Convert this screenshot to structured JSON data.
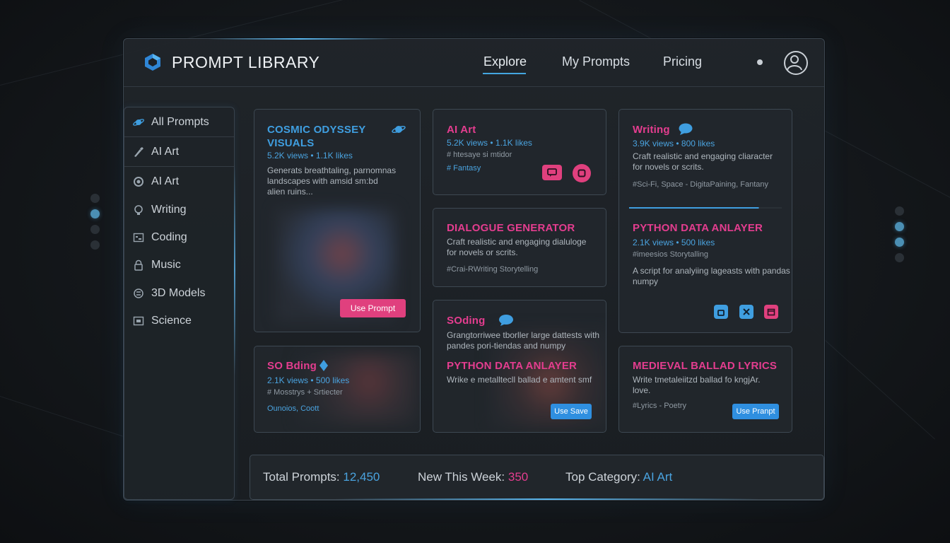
{
  "app": {
    "title": "PROMPT LIBRARY"
  },
  "nav": {
    "explore": "Explore",
    "my_prompts": "My Prompts",
    "pricing": "Pricing"
  },
  "sidebar": {
    "items": [
      {
        "label": "All Prompts",
        "icon": "planet-icon"
      },
      {
        "label": "AI Art",
        "icon": "brush-icon"
      },
      {
        "label": "AI Art",
        "icon": "circle-icon"
      },
      {
        "label": "Writing",
        "icon": "bulb-icon"
      },
      {
        "label": "Coding",
        "icon": "code-icon"
      },
      {
        "label": "Music",
        "icon": "lock-icon"
      },
      {
        "label": "3D Models",
        "icon": "cube-icon"
      },
      {
        "label": "Science",
        "icon": "flask-icon"
      }
    ]
  },
  "cards": {
    "cosmic": {
      "title_line1": "COSMIC ODYSSEY",
      "title_line2": "VISUALS",
      "stats": "5.2K views • 1.1K likes",
      "desc_line1": "Generats breathtaling, parnomnas",
      "desc_line2": "landscapes with amsid sm:bd",
      "desc_line3": "alien ruins...",
      "button": "Use Prompt"
    },
    "aiart": {
      "title": "AI Art",
      "stats": "5.2K views • 1.1K likes",
      "sub": "# htesaye si mtidor",
      "tags": "# Fantasy"
    },
    "writing": {
      "title": "Writing",
      "stats": "3.9K views • 800 likes",
      "desc_line1": "Craft realistic and engaging cliaracter",
      "desc_line2": "for novels or scrits.",
      "tags": "#Sci-Fi, Space - DigitaPaining, Fantany"
    },
    "dialogue": {
      "title": "DIALOGUE GENERATOR",
      "desc_line1": "Craft realistic and engaging dialuloge",
      "desc_line2": "for novels or scrits.",
      "tags": "#Crai-RWriting Storytelling"
    },
    "python_right": {
      "title": "PYTHON DATA ANLAYER",
      "stats": "2.1K views • 500 likes",
      "sub": "#imeesios Storytalling",
      "desc_line1": "A script for analyiing lageasts with pandas",
      "desc_line2": "numpy"
    },
    "sodbing": {
      "title": "SO Bding",
      "stats": "2.1K views • 500 likes",
      "sub": "# Mosstrys + Srtiecter",
      "tags": "Ounoios, Coott"
    },
    "soding_python": {
      "title": "SOding",
      "desc_line1": "Grangtorriwee tborller large dattests with",
      "desc_line2": "pandes pori-tiendas and numpy",
      "title2": "PYTHON DATA ANLAYER",
      "desc2": "Wrike e metalltecll ballad e amtent smf",
      "button": "Use Save"
    },
    "medieval": {
      "title": "MEDIEVAL BALLAD LYRICS",
      "desc_line1": "Write tmetaleiitzd ballad fo kngjAr.",
      "desc_line2": "love.",
      "tags": "#Lyrics - Poetry",
      "button": "Use Pranpt"
    }
  },
  "footer": {
    "total_label": "Total Prompts:",
    "total_value": "12,450",
    "new_label": "New This Week:",
    "new_value": "350",
    "top_label": "Top Category:",
    "top_value": "AI Art"
  },
  "colors": {
    "accent_blue": "#3f9ee0",
    "accent_pink": "#e43d8f",
    "bg": "#15181c"
  }
}
